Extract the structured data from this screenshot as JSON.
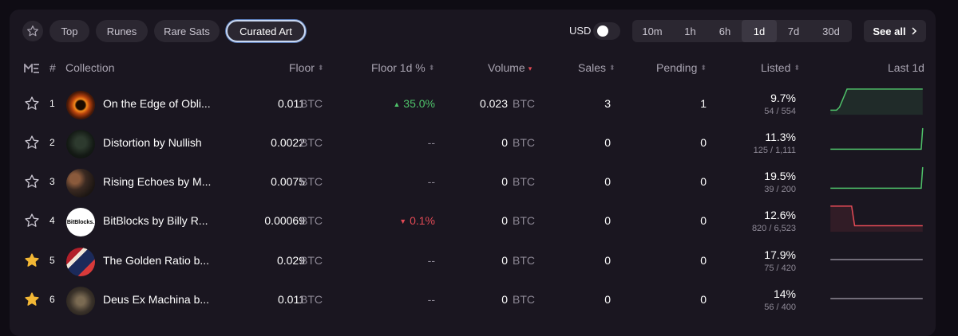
{
  "filters": {
    "tabs": [
      "Top",
      "Runes",
      "Rare Sats",
      "Curated Art"
    ],
    "active_tab": "Curated Art",
    "currency_label": "USD",
    "timeframes": [
      "10m",
      "1h",
      "6h",
      "1d",
      "7d",
      "30d"
    ],
    "active_timeframe": "1d",
    "see_all_label": "See all"
  },
  "table": {
    "headers": {
      "rank": "#",
      "collection": "Collection",
      "floor": "Floor",
      "floor_change": "Floor 1d %",
      "volume": "Volume",
      "sales": "Sales",
      "pending": "Pending",
      "listed": "Listed",
      "last": "Last 1d"
    },
    "rows": [
      {
        "rank": "1",
        "name": "On the Edge of Obli...",
        "floor": "0.011",
        "floor_unit": "BTC",
        "change": "35.0%",
        "change_dir": "up",
        "volume": "0.023",
        "volume_unit": "BTC",
        "sales": "3",
        "pending": "1",
        "listed_pct": "9.7%",
        "listed_count": "54 / 554",
        "favorite": false,
        "trend": "up"
      },
      {
        "rank": "2",
        "name": "Distortion by Nullish",
        "floor": "0.0022",
        "floor_unit": "BTC",
        "change": "--",
        "change_dir": "none",
        "volume": "0",
        "volume_unit": "BTC",
        "sales": "0",
        "pending": "0",
        "listed_pct": "11.3%",
        "listed_count": "125 / 1,111",
        "favorite": false,
        "trend": "up-late"
      },
      {
        "rank": "3",
        "name": "Rising Echoes by M...",
        "floor": "0.0075",
        "floor_unit": "BTC",
        "change": "--",
        "change_dir": "none",
        "volume": "0",
        "volume_unit": "BTC",
        "sales": "0",
        "pending": "0",
        "listed_pct": "19.5%",
        "listed_count": "39 / 200",
        "favorite": false,
        "trend": "up-late"
      },
      {
        "rank": "4",
        "name": "BitBlocks by Billy R...",
        "floor": "0.00069",
        "floor_unit": "BTC",
        "change": "0.1%",
        "change_dir": "down",
        "volume": "0",
        "volume_unit": "BTC",
        "sales": "0",
        "pending": "0",
        "listed_pct": "12.6%",
        "listed_count": "820 / 6,523",
        "favorite": false,
        "trend": "down"
      },
      {
        "rank": "5",
        "name": "The Golden Ratio b...",
        "floor": "0.029",
        "floor_unit": "BTC",
        "change": "--",
        "change_dir": "none",
        "volume": "0",
        "volume_unit": "BTC",
        "sales": "0",
        "pending": "0",
        "listed_pct": "17.9%",
        "listed_count": "75 / 420",
        "favorite": true,
        "trend": "flat"
      },
      {
        "rank": "6",
        "name": "Deus Ex Machina b...",
        "floor": "0.011",
        "floor_unit": "BTC",
        "change": "--",
        "change_dir": "none",
        "volume": "0",
        "volume_unit": "BTC",
        "sales": "0",
        "pending": "0",
        "listed_pct": "14%",
        "listed_count": "56 / 400",
        "favorite": true,
        "trend": "flat"
      }
    ]
  },
  "thumb_labels": {
    "bitblocks": "BitBlocks."
  },
  "colors": {
    "up": "#4fc26a",
    "down": "#e24a55",
    "flat": "#8e8996",
    "favorite": "#f2b735"
  }
}
